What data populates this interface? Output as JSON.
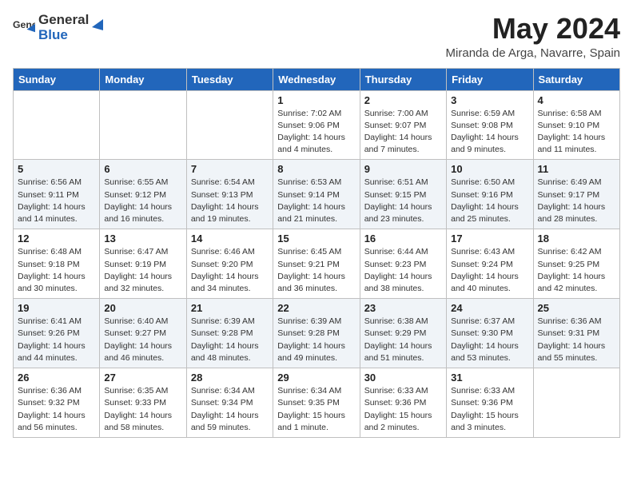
{
  "header": {
    "logo_general": "General",
    "logo_blue": "Blue",
    "month_year": "May 2024",
    "location": "Miranda de Arga, Navarre, Spain"
  },
  "columns": [
    "Sunday",
    "Monday",
    "Tuesday",
    "Wednesday",
    "Thursday",
    "Friday",
    "Saturday"
  ],
  "weeks": [
    {
      "days": [
        {
          "num": "",
          "info": ""
        },
        {
          "num": "",
          "info": ""
        },
        {
          "num": "",
          "info": ""
        },
        {
          "num": "1",
          "info": "Sunrise: 7:02 AM\nSunset: 9:06 PM\nDaylight: 14 hours\nand 4 minutes."
        },
        {
          "num": "2",
          "info": "Sunrise: 7:00 AM\nSunset: 9:07 PM\nDaylight: 14 hours\nand 7 minutes."
        },
        {
          "num": "3",
          "info": "Sunrise: 6:59 AM\nSunset: 9:08 PM\nDaylight: 14 hours\nand 9 minutes."
        },
        {
          "num": "4",
          "info": "Sunrise: 6:58 AM\nSunset: 9:10 PM\nDaylight: 14 hours\nand 11 minutes."
        }
      ]
    },
    {
      "days": [
        {
          "num": "5",
          "info": "Sunrise: 6:56 AM\nSunset: 9:11 PM\nDaylight: 14 hours\nand 14 minutes."
        },
        {
          "num": "6",
          "info": "Sunrise: 6:55 AM\nSunset: 9:12 PM\nDaylight: 14 hours\nand 16 minutes."
        },
        {
          "num": "7",
          "info": "Sunrise: 6:54 AM\nSunset: 9:13 PM\nDaylight: 14 hours\nand 19 minutes."
        },
        {
          "num": "8",
          "info": "Sunrise: 6:53 AM\nSunset: 9:14 PM\nDaylight: 14 hours\nand 21 minutes."
        },
        {
          "num": "9",
          "info": "Sunrise: 6:51 AM\nSunset: 9:15 PM\nDaylight: 14 hours\nand 23 minutes."
        },
        {
          "num": "10",
          "info": "Sunrise: 6:50 AM\nSunset: 9:16 PM\nDaylight: 14 hours\nand 25 minutes."
        },
        {
          "num": "11",
          "info": "Sunrise: 6:49 AM\nSunset: 9:17 PM\nDaylight: 14 hours\nand 28 minutes."
        }
      ]
    },
    {
      "days": [
        {
          "num": "12",
          "info": "Sunrise: 6:48 AM\nSunset: 9:18 PM\nDaylight: 14 hours\nand 30 minutes."
        },
        {
          "num": "13",
          "info": "Sunrise: 6:47 AM\nSunset: 9:19 PM\nDaylight: 14 hours\nand 32 minutes."
        },
        {
          "num": "14",
          "info": "Sunrise: 6:46 AM\nSunset: 9:20 PM\nDaylight: 14 hours\nand 34 minutes."
        },
        {
          "num": "15",
          "info": "Sunrise: 6:45 AM\nSunset: 9:21 PM\nDaylight: 14 hours\nand 36 minutes."
        },
        {
          "num": "16",
          "info": "Sunrise: 6:44 AM\nSunset: 9:23 PM\nDaylight: 14 hours\nand 38 minutes."
        },
        {
          "num": "17",
          "info": "Sunrise: 6:43 AM\nSunset: 9:24 PM\nDaylight: 14 hours\nand 40 minutes."
        },
        {
          "num": "18",
          "info": "Sunrise: 6:42 AM\nSunset: 9:25 PM\nDaylight: 14 hours\nand 42 minutes."
        }
      ]
    },
    {
      "days": [
        {
          "num": "19",
          "info": "Sunrise: 6:41 AM\nSunset: 9:26 PM\nDaylight: 14 hours\nand 44 minutes."
        },
        {
          "num": "20",
          "info": "Sunrise: 6:40 AM\nSunset: 9:27 PM\nDaylight: 14 hours\nand 46 minutes."
        },
        {
          "num": "21",
          "info": "Sunrise: 6:39 AM\nSunset: 9:28 PM\nDaylight: 14 hours\nand 48 minutes."
        },
        {
          "num": "22",
          "info": "Sunrise: 6:39 AM\nSunset: 9:28 PM\nDaylight: 14 hours\nand 49 minutes."
        },
        {
          "num": "23",
          "info": "Sunrise: 6:38 AM\nSunset: 9:29 PM\nDaylight: 14 hours\nand 51 minutes."
        },
        {
          "num": "24",
          "info": "Sunrise: 6:37 AM\nSunset: 9:30 PM\nDaylight: 14 hours\nand 53 minutes."
        },
        {
          "num": "25",
          "info": "Sunrise: 6:36 AM\nSunset: 9:31 PM\nDaylight: 14 hours\nand 55 minutes."
        }
      ]
    },
    {
      "days": [
        {
          "num": "26",
          "info": "Sunrise: 6:36 AM\nSunset: 9:32 PM\nDaylight: 14 hours\nand 56 minutes."
        },
        {
          "num": "27",
          "info": "Sunrise: 6:35 AM\nSunset: 9:33 PM\nDaylight: 14 hours\nand 58 minutes."
        },
        {
          "num": "28",
          "info": "Sunrise: 6:34 AM\nSunset: 9:34 PM\nDaylight: 14 hours\nand 59 minutes."
        },
        {
          "num": "29",
          "info": "Sunrise: 6:34 AM\nSunset: 9:35 PM\nDaylight: 15 hours\nand 1 minute."
        },
        {
          "num": "30",
          "info": "Sunrise: 6:33 AM\nSunset: 9:36 PM\nDaylight: 15 hours\nand 2 minutes."
        },
        {
          "num": "31",
          "info": "Sunrise: 6:33 AM\nSunset: 9:36 PM\nDaylight: 15 hours\nand 3 minutes."
        },
        {
          "num": "",
          "info": ""
        }
      ]
    }
  ]
}
